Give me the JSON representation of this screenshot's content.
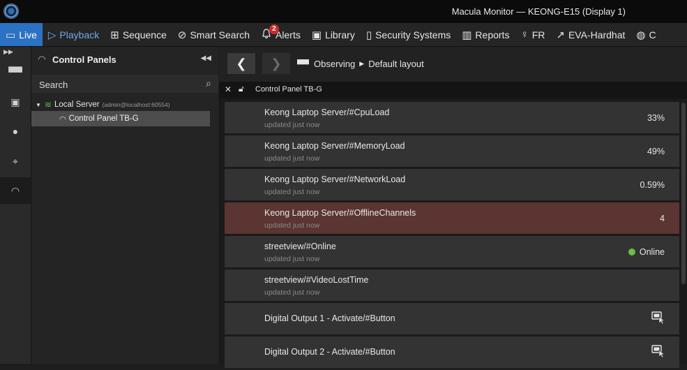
{
  "window": {
    "title": "Macula Monitor — KEONG-E15 (Display 1)"
  },
  "menubar": {
    "items": [
      {
        "label": "Live",
        "icon": "monitor-icon",
        "glyph": "▭"
      },
      {
        "label": "Playback",
        "icon": "play-icon",
        "glyph": "▷"
      },
      {
        "label": "Sequence",
        "icon": "sequence-grid-icon",
        "glyph": "⊞"
      },
      {
        "label": "Smart Search",
        "icon": "smart-search-icon",
        "glyph": "⊘"
      },
      {
        "label": "Alerts",
        "icon": "bell-icon",
        "glyph": "🔔︎",
        "badge": "2"
      },
      {
        "label": "Library",
        "icon": "library-icon",
        "glyph": "▣"
      },
      {
        "label": "Security Systems",
        "icon": "security-systems-icon",
        "glyph": "▯"
      },
      {
        "label": "Reports",
        "icon": "bar-chart-icon",
        "glyph": "▥"
      },
      {
        "label": "FR",
        "icon": "face-recognition-icon",
        "glyph": "♀"
      },
      {
        "label": "EVA-Hardhat",
        "icon": "external-link-icon",
        "glyph": "↗"
      },
      {
        "label": "C",
        "icon": "globe-www-icon",
        "glyph": "◍"
      }
    ]
  },
  "panel": {
    "title": "Control Panels",
    "search": {
      "value": "",
      "placeholder": "Search"
    },
    "tree": {
      "server": {
        "label": "Local Server",
        "detail": "(admin@localhost:60554)"
      },
      "child": {
        "label": "Control Panel TB-G"
      }
    }
  },
  "nav": {
    "breadcrumb": {
      "first": "Observing",
      "second": "Default layout"
    }
  },
  "tab": {
    "title": "Control Panel TB-G"
  },
  "rows": [
    {
      "title": "Keong Laptop Server/#CpuLoad",
      "sub": "updated just now",
      "value": "33%"
    },
    {
      "title": "Keong Laptop Server/#MemoryLoad",
      "sub": "updated just now",
      "value": "49%"
    },
    {
      "title": "Keong Laptop Server/#NetworkLoad",
      "sub": "updated just now",
      "value": "0.59%"
    },
    {
      "title": "Keong Laptop Server/#OfflineChannels",
      "sub": "updated just now",
      "value": "4"
    },
    {
      "title": "streetview/#Online",
      "sub": "updated just now",
      "value": "Online",
      "status_color": "#6cbf45"
    },
    {
      "title": "streetview/#VideoLostTime",
      "sub": "updated just now",
      "value": ""
    },
    {
      "title": "Digital Output 1 - Activate/#Button",
      "icon": "click-button-icon"
    },
    {
      "title": "Digital Output 2 - Activate/#Button",
      "icon": "click-button-icon"
    }
  ],
  "colors": {
    "accent": "#2c72c4",
    "alert_row": "#5a3531",
    "online": "#6cbf45",
    "badge": "#d6262b"
  }
}
